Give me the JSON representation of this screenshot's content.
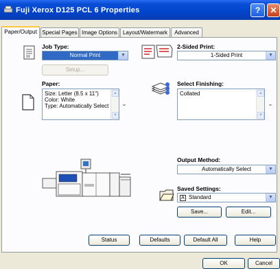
{
  "window": {
    "title": "Fuji Xerox D125 PCL 6 Properties"
  },
  "tabs": [
    {
      "label": "Paper/Output",
      "active": true
    },
    {
      "label": "Special Pages"
    },
    {
      "label": "Image Options"
    },
    {
      "label": "Layout/Watermark"
    },
    {
      "label": "Advanced"
    }
  ],
  "job_type": {
    "label": "Job Type:",
    "value": "Normal Print",
    "setup_label": "Setup..."
  },
  "sided_print": {
    "label": "2-Sided Print:",
    "value": "1-Sided Print"
  },
  "paper": {
    "label": "Paper:",
    "lines": [
      "Size: Letter (8.5 x 11\")",
      "Color: White",
      "Type: Automatically Select"
    ]
  },
  "finishing": {
    "label": "Select Finishing:",
    "value": "Collated"
  },
  "output_method": {
    "label": "Output Method:",
    "value": "Automatically Select"
  },
  "saved_settings": {
    "label": "Saved Settings:",
    "value": "Standard",
    "save_label": "Save...",
    "edit_label": "Edit..."
  },
  "bottom_buttons": {
    "status": "Status",
    "defaults": "Defaults",
    "default_all": "Default All",
    "help": "Help"
  },
  "dialog": {
    "ok": "OK",
    "cancel": "Cancel"
  }
}
